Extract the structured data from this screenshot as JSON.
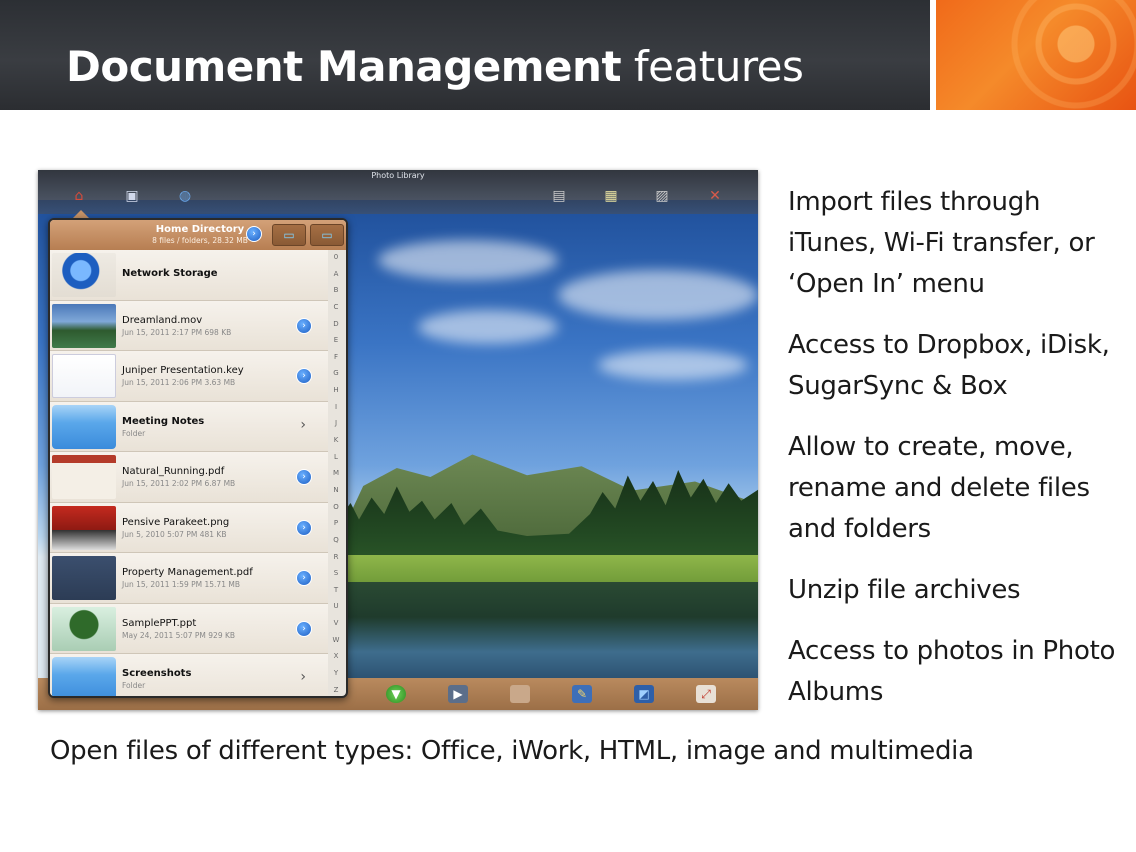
{
  "slide": {
    "title_bold": "Document Management",
    "title_rest": "features",
    "bullets": [
      "Import files through iTunes, Wi-Fi transfer, or ‘Open In’ menu",
      "Access to Dropbox, iDisk, SugarSync & Box",
      "Allow to create, move, rename and delete files and folders",
      "Unzip file archives",
      "Access to photos in Photo Albums"
    ],
    "footer": "Open files of different types: Office, iWork, HTML, image and multimedia"
  },
  "screenshot": {
    "window_title": "Photo Library",
    "panel": {
      "title": "Home Directory",
      "subtitle": "8 files / folders, 28.32 MB",
      "rows": [
        {
          "name": "Network Storage",
          "meta": "",
          "kind": "network"
        },
        {
          "name": "Dreamland.mov",
          "meta": "Jun 15, 2011 2:17 PM    698 KB",
          "kind": "file"
        },
        {
          "name": "Juniper Presentation.key",
          "meta": "Jun 15, 2011 2:06 PM    3.63 MB",
          "kind": "file"
        },
        {
          "name": "Meeting Notes",
          "meta": "Folder",
          "kind": "folder"
        },
        {
          "name": "Natural_Running.pdf",
          "meta": "Jun 15, 2011 2:02 PM    6.87 MB",
          "kind": "file"
        },
        {
          "name": "Pensive Parakeet.png",
          "meta": "Jun 5, 2010 5:07 PM    481 KB",
          "kind": "file"
        },
        {
          "name": "Property Management.pdf",
          "meta": "Jun 15, 2011 1:59 PM    15.71 MB",
          "kind": "file"
        },
        {
          "name": "SamplePPT.ppt",
          "meta": "May 24, 2011 5:07 PM    929 KB",
          "kind": "file"
        },
        {
          "name": "Screenshots",
          "meta": "Folder",
          "kind": "folder"
        }
      ],
      "index_letters": [
        "0",
        "A",
        "B",
        "C",
        "D",
        "E",
        "F",
        "G",
        "H",
        "I",
        "J",
        "K",
        "L",
        "M",
        "N",
        "O",
        "P",
        "Q",
        "R",
        "S",
        "T",
        "U",
        "V",
        "W",
        "X",
        "Y",
        "Z"
      ]
    },
    "top_icons": [
      "home-icon",
      "photos-icon",
      "globe-icon",
      "folder-icon",
      "note-icon",
      "image-icon",
      "tools-icon"
    ],
    "bottom_icons": [
      "download-icon",
      "slideshow-icon",
      "frame-icon",
      "edit-icon",
      "crop-icon",
      "fullscreen-icon"
    ]
  },
  "colors": {
    "header_bg": "#2c2f34",
    "accent_orange": "#f06a1a",
    "toolbar_wood": "#b98a5e",
    "detail_blue": "#1e5fc4"
  }
}
